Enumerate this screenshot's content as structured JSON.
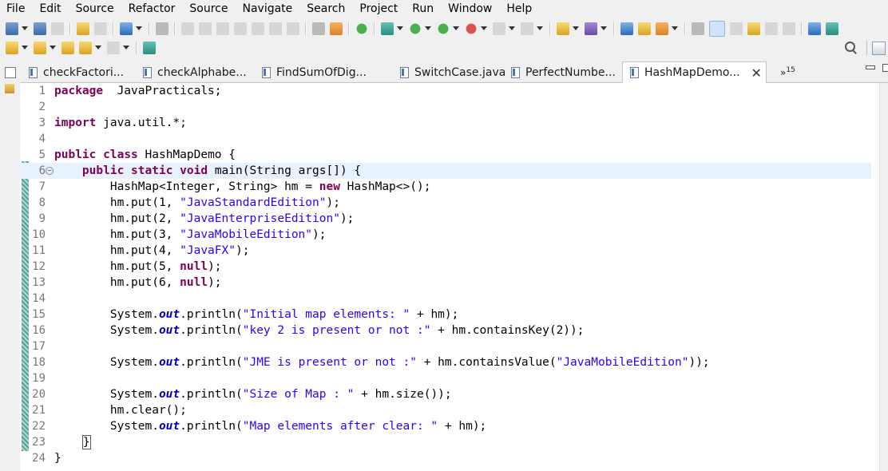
{
  "menu": [
    "File",
    "Edit",
    "Source",
    "Refactor",
    "Source",
    "Navigate",
    "Search",
    "Project",
    "Run",
    "Window",
    "Help"
  ],
  "tabs": [
    {
      "label": "checkFactori...",
      "active": false
    },
    {
      "label": "checkAlphabe...",
      "active": false
    },
    {
      "label": "FindSumOfDig...",
      "active": false
    },
    {
      "label": "SwitchCase.java",
      "active": false
    },
    {
      "label": "PerfectNumbe...",
      "active": false
    },
    {
      "label": "HashMapDemo...",
      "active": true
    }
  ],
  "tab_overflow": {
    "label": "»",
    "count": "15"
  },
  "editor": {
    "current_line": 6,
    "lines": [
      {
        "n": "1",
        "tokens": [
          [
            "kw",
            "package"
          ],
          [
            "",
            "  JavaPracticals;"
          ]
        ]
      },
      {
        "n": "2",
        "tokens": []
      },
      {
        "n": "3",
        "tokens": [
          [
            "kw",
            "import"
          ],
          [
            "",
            " java.util.*;"
          ]
        ]
      },
      {
        "n": "4",
        "tokens": []
      },
      {
        "n": "5",
        "tokens": [
          [
            "kw",
            "public"
          ],
          [
            "",
            " "
          ],
          [
            "kw",
            "class"
          ],
          [
            "",
            " HashMapDemo {"
          ]
        ]
      },
      {
        "n": "6",
        "fold": true,
        "tokens": [
          [
            "",
            "    "
          ],
          [
            "kw",
            "public"
          ],
          [
            "",
            " "
          ],
          [
            "kw",
            "static"
          ],
          [
            "",
            " "
          ],
          [
            "kw",
            "void"
          ],
          [
            "",
            " main(String args[]) {"
          ]
        ]
      },
      {
        "n": "7",
        "tokens": [
          [
            "",
            "        HashMap<Integer, String> hm = "
          ],
          [
            "kw",
            "new"
          ],
          [
            "",
            " HashMap<>();"
          ]
        ]
      },
      {
        "n": "8",
        "tokens": [
          [
            "",
            "        hm.put(1, "
          ],
          [
            "str",
            "\"JavaStandardEdition\""
          ],
          [
            "",
            ");"
          ]
        ]
      },
      {
        "n": "9",
        "tokens": [
          [
            "",
            "        hm.put(2, "
          ],
          [
            "str",
            "\"JavaEnterpriseEdition\""
          ],
          [
            "",
            ");"
          ]
        ]
      },
      {
        "n": "10",
        "tokens": [
          [
            "",
            "        hm.put(3, "
          ],
          [
            "str",
            "\"JavaMobileEdition\""
          ],
          [
            "",
            ");"
          ]
        ]
      },
      {
        "n": "11",
        "tokens": [
          [
            "",
            "        hm.put(4, "
          ],
          [
            "str",
            "\"JavaFX\""
          ],
          [
            "",
            ");"
          ]
        ]
      },
      {
        "n": "12",
        "tokens": [
          [
            "",
            "        hm.put(5, "
          ],
          [
            "kw",
            "null"
          ],
          [
            "",
            ");"
          ]
        ]
      },
      {
        "n": "13",
        "tokens": [
          [
            "",
            "        hm.put(6, "
          ],
          [
            "kw",
            "null"
          ],
          [
            "",
            ");"
          ]
        ]
      },
      {
        "n": "14",
        "tokens": []
      },
      {
        "n": "15",
        "tokens": [
          [
            "",
            "        System."
          ],
          [
            "fld",
            "out"
          ],
          [
            "",
            ".println("
          ],
          [
            "str",
            "\"Initial map elements: \""
          ],
          [
            "",
            " + hm);"
          ]
        ]
      },
      {
        "n": "16",
        "tokens": [
          [
            "",
            "        System."
          ],
          [
            "fld",
            "out"
          ],
          [
            "",
            ".println("
          ],
          [
            "str",
            "\"key 2 is present or not :\""
          ],
          [
            "",
            " + hm.containsKey(2));"
          ]
        ]
      },
      {
        "n": "17",
        "tokens": []
      },
      {
        "n": "18",
        "tokens": [
          [
            "",
            "        System."
          ],
          [
            "fld",
            "out"
          ],
          [
            "",
            ".println("
          ],
          [
            "str",
            "\"JME is present or not :\""
          ],
          [
            "",
            " + hm.containsValue("
          ],
          [
            "str",
            "\"JavaMobileEdition\""
          ],
          [
            "",
            "));"
          ]
        ]
      },
      {
        "n": "19",
        "tokens": []
      },
      {
        "n": "20",
        "tokens": [
          [
            "",
            "        System."
          ],
          [
            "fld",
            "out"
          ],
          [
            "",
            ".println("
          ],
          [
            "str",
            "\"Size of Map : \""
          ],
          [
            "",
            " + hm.size());"
          ]
        ]
      },
      {
        "n": "21",
        "tokens": [
          [
            "",
            "        hm.clear();"
          ]
        ]
      },
      {
        "n": "22",
        "tokens": [
          [
            "",
            "        System."
          ],
          [
            "fld",
            "out"
          ],
          [
            "",
            ".println("
          ],
          [
            "str",
            "\"Map elements after clear: \""
          ],
          [
            "",
            " + hm);"
          ]
        ]
      },
      {
        "n": "23",
        "tokens": [
          [
            "",
            "    "
          ],
          [
            "cursor",
            "}"
          ]
        ]
      },
      {
        "n": "24",
        "tokens": [
          [
            "",
            "}"
          ]
        ]
      }
    ]
  }
}
